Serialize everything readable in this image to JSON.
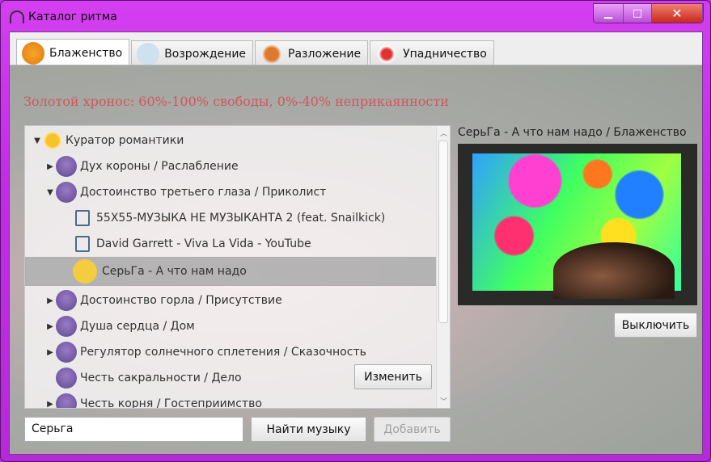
{
  "window": {
    "title": "Каталог ритма"
  },
  "tabs": [
    {
      "label": "Блаженство",
      "active": true
    },
    {
      "label": "Возрождение"
    },
    {
      "label": "Разложение"
    },
    {
      "label": "Упадничество"
    }
  ],
  "heading": "Золотой хронос: 60%-100% свободы, 0%-40% неприкаянности",
  "tree": {
    "root": "Куратор романтики",
    "items": [
      {
        "label": "Дух короны / Раслабление"
      },
      {
        "label": "Достоинство третьего глаза / Приколист"
      },
      {
        "label": "55X55-МУЗЫКА НЕ МУЗЫКАНТА 2 (feat. Snailkick)"
      },
      {
        "label": "David Garrett - Viva La Vida - YouTube"
      },
      {
        "label": "СерьГа - А что нам надо"
      },
      {
        "label": "Достоинство горла / Присутствие"
      },
      {
        "label": "Душа сердца / Дом"
      },
      {
        "label": "Регулятор солнечного сплетения / Сказочность"
      },
      {
        "label": "Честь сакральности / Дело"
      },
      {
        "label": "Честь корня / Гостеприимство"
      }
    ]
  },
  "player": {
    "now_playing": "СерьГа - А что нам надо / Блаженство",
    "stop_label": "Выключить"
  },
  "edit_label": "Изменить",
  "search": {
    "value": "Серьга",
    "find_label": "Найти музыку",
    "add_label": "Добавить"
  }
}
